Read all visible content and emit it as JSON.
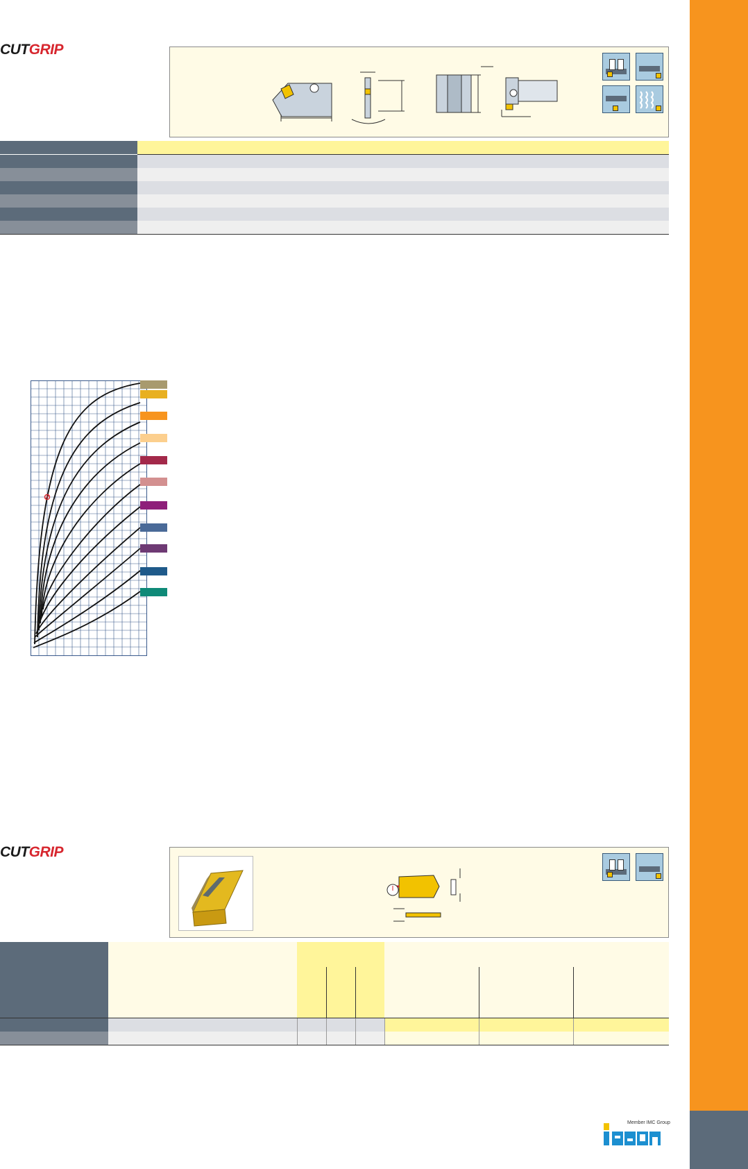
{
  "top_section": {
    "brand": {
      "part1": "CUT",
      "part2": "GRIP"
    }
  },
  "bottom_section": {
    "brand": {
      "part1": "CUT",
      "part2": "GRIP"
    }
  },
  "footer": {
    "member_text": "Member IMC Group",
    "logo_alt": "ISCAR"
  },
  "colors": {
    "sidebar": "#f7941e",
    "header_dark": "#5c6b7a",
    "header_mid": "#878f99",
    "panel_bg": "#fffbe6",
    "highlight_yellow": "#fff59a",
    "grid_line": "#3a5a8c"
  },
  "chart_swatches": [
    "#a89a6e",
    "#e8b020",
    "#f7941e",
    "#fccf8e",
    "#a3294a",
    "#d39090",
    "#8e1f7a",
    "#4a6a98",
    "#6e3a74",
    "#1f5a8a",
    "#0f8a78"
  ]
}
